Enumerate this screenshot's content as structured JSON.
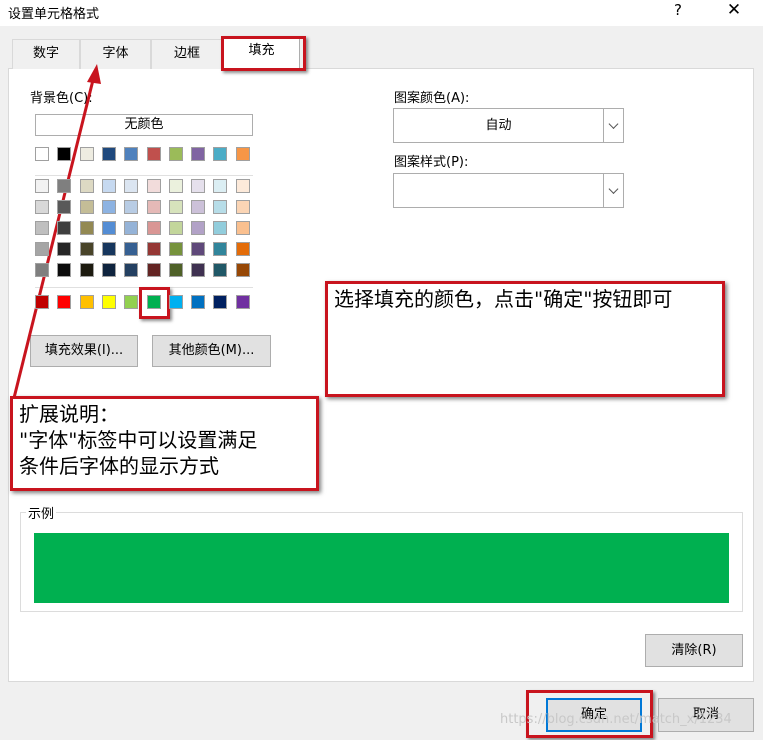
{
  "window": {
    "title": "设置单元格格式",
    "help": "?",
    "close": "✕"
  },
  "tabs": [
    {
      "label": "数字"
    },
    {
      "label": "字体"
    },
    {
      "label": "边框"
    },
    {
      "label": "填充"
    }
  ],
  "fill": {
    "bg_label": "背景色(C):",
    "no_color": "无颜色",
    "pattern_color_label": "图案颜色(A):",
    "pattern_color_value": "自动",
    "pattern_style_label": "图案样式(P):",
    "pattern_style_value": "",
    "fill_effects": "填充效果(I)...",
    "more_colors": "其他颜色(M)...",
    "sample_label": "示例",
    "sample_color": "#00B050",
    "clear": "清除(R)"
  },
  "palette": {
    "row0": [
      "#FFFFFF",
      "#000000",
      "#EEECE1",
      "#1F497D",
      "#4F81BD",
      "#C0504D",
      "#9BBB59",
      "#8064A2",
      "#4BACC6",
      "#F79646"
    ],
    "tints": [
      [
        "#F2F2F2",
        "#7F7F7F",
        "#DDD9C3",
        "#C6D9F0",
        "#DBE5F1",
        "#F2DCDB",
        "#EBF1DD",
        "#E5E0EC",
        "#DBEEF3",
        "#FDEADA"
      ],
      [
        "#D8D8D8",
        "#595959",
        "#C4BD97",
        "#8DB3E2",
        "#B8CCE4",
        "#E5B9B7",
        "#D7E3BC",
        "#CCC1D9",
        "#B7DDE8",
        "#FBD5B5"
      ],
      [
        "#BFBFBF",
        "#3F3F3F",
        "#938953",
        "#548DD4",
        "#95B3D7",
        "#D99694",
        "#C3D69B",
        "#B2A2C7",
        "#92CDDC",
        "#FAC08F"
      ],
      [
        "#A5A5A5",
        "#262626",
        "#494429",
        "#17365D",
        "#366092",
        "#953734",
        "#76923C",
        "#5F497A",
        "#31859B",
        "#E36C09"
      ],
      [
        "#7F7F7F",
        "#0C0C0C",
        "#1D1B10",
        "#0F243E",
        "#244061",
        "#632423",
        "#4F6128",
        "#3F3151",
        "#205867",
        "#974806"
      ]
    ],
    "standard": [
      "#C00000",
      "#FF0000",
      "#FFC000",
      "#FFFF00",
      "#92D050",
      "#00B050",
      "#00B0F0",
      "#0070C0",
      "#002060",
      "#7030A0"
    ],
    "selected_index": 5
  },
  "annotations": {
    "note1": "选择填充的颜色，点击\"确定\"按钮即可",
    "note2_line1": "扩展说明：",
    "note2_line2": "\"字体\"标签中可以设置满足",
    "note2_line3": "条件后字体的显示方式"
  },
  "footer": {
    "ok": "确定",
    "cancel": "取消"
  },
  "watermark": "https://blog.csdn.net/match_x/1234",
  "colors": {
    "accent_red": "#C8141E",
    "ok_border": "#0078D7"
  }
}
